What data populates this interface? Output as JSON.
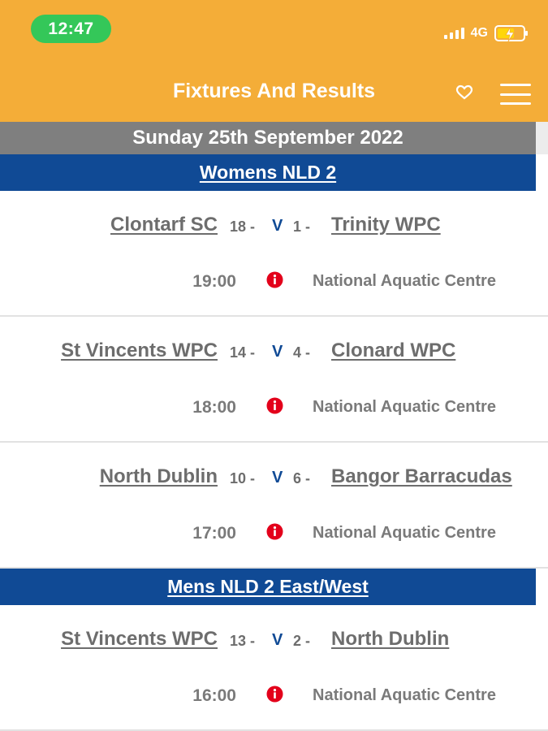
{
  "status_bar": {
    "time": "12:47",
    "network": "4G"
  },
  "header": {
    "title": "Fixtures And Results",
    "favorite_icon": "heart-icon",
    "menu_icon": "hamburger-menu-icon"
  },
  "date": "Sunday 25th September 2022",
  "leagues": [
    {
      "name": "Womens NLD 2",
      "matches": [
        {
          "home": "Clontarf SC",
          "home_score": "18 -",
          "vs": "V",
          "away_score": "1 -",
          "away": "Trinity WPC",
          "time": "19:00",
          "venue": "National Aquatic Centre"
        },
        {
          "home": "St Vincents WPC",
          "home_score": "14 -",
          "vs": "V",
          "away_score": "4 -",
          "away": "Clonard WPC",
          "time": "18:00",
          "venue": "National Aquatic Centre"
        },
        {
          "home": "North Dublin",
          "home_score": "10 -",
          "vs": "V",
          "away_score": "6 -",
          "away": "Bangor Barracudas",
          "time": "17:00",
          "venue": "National Aquatic Centre"
        }
      ]
    },
    {
      "name": "Mens NLD 2 East/West",
      "matches": [
        {
          "home": "St Vincents WPC",
          "home_score": "13 -",
          "vs": "V",
          "away_score": "2 -",
          "away": "North Dublin",
          "time": "16:00",
          "venue": "National Aquatic Centre"
        }
      ]
    }
  ],
  "colors": {
    "header_bg": "#F4AD38",
    "league_bg": "#104A95",
    "date_bg": "#7F7F7F",
    "info_icon": "#E3001B",
    "time_pill": "#34C759"
  }
}
